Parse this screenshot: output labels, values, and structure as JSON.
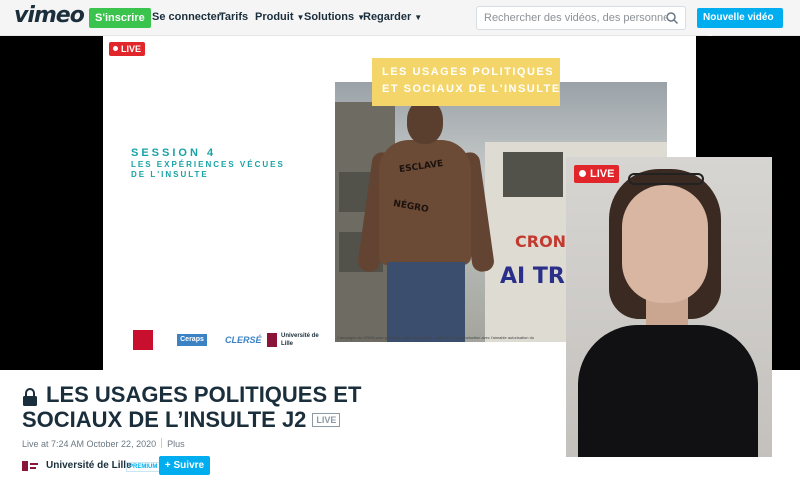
{
  "nav": {
    "logo": "vimeo",
    "signup": "S'inscrire",
    "login": "Se connecter",
    "pricing": "Tarifs",
    "product": "Produit",
    "solutions": "Solutions",
    "watch": "Regarder",
    "search_placeholder": "Rechercher des vidéos, des personnes, des",
    "new_video": "Nouvelle vidéo"
  },
  "player": {
    "live_badge": "LIVE",
    "slide": {
      "banner_line1": "LES USAGES POLITIQUES",
      "banner_line2": "ET SOCIAUX DE L'INSULTE",
      "session_title": "SESSION 4",
      "session_line1": "LES EXPÉRIENCES VÉCUES",
      "session_line2": "DE L'INSULTE",
      "photo_caption": "Campagne du CRAN pour protester contre le racisme - Avril 2017 / Reproduction avec l'aimable autorisation du",
      "logos": [
        "SCIENCES PO LILLE",
        "Ceraps",
        "CLERSÉ",
        "Université de Lille"
      ]
    },
    "webcam_badge": "LIVE"
  },
  "video": {
    "title_line1": "LES USAGES POLITIQUES ET",
    "title_line2": "SOCIAUX DE L’INSULTE J2",
    "live_tag": "LIVE",
    "live_at": "Live at 7:24 AM October 22, 2020",
    "more": "Plus",
    "channel": "Université de Lille",
    "premium": "PREMIUM",
    "follow": "+ Suivre"
  },
  "colors": {
    "signup_green": "#3ac34d",
    "vimeo_blue": "#00adef",
    "live_red": "#e0262b",
    "slide_teal": "#17a3a6",
    "banner_yellow": "#f4d56a"
  }
}
